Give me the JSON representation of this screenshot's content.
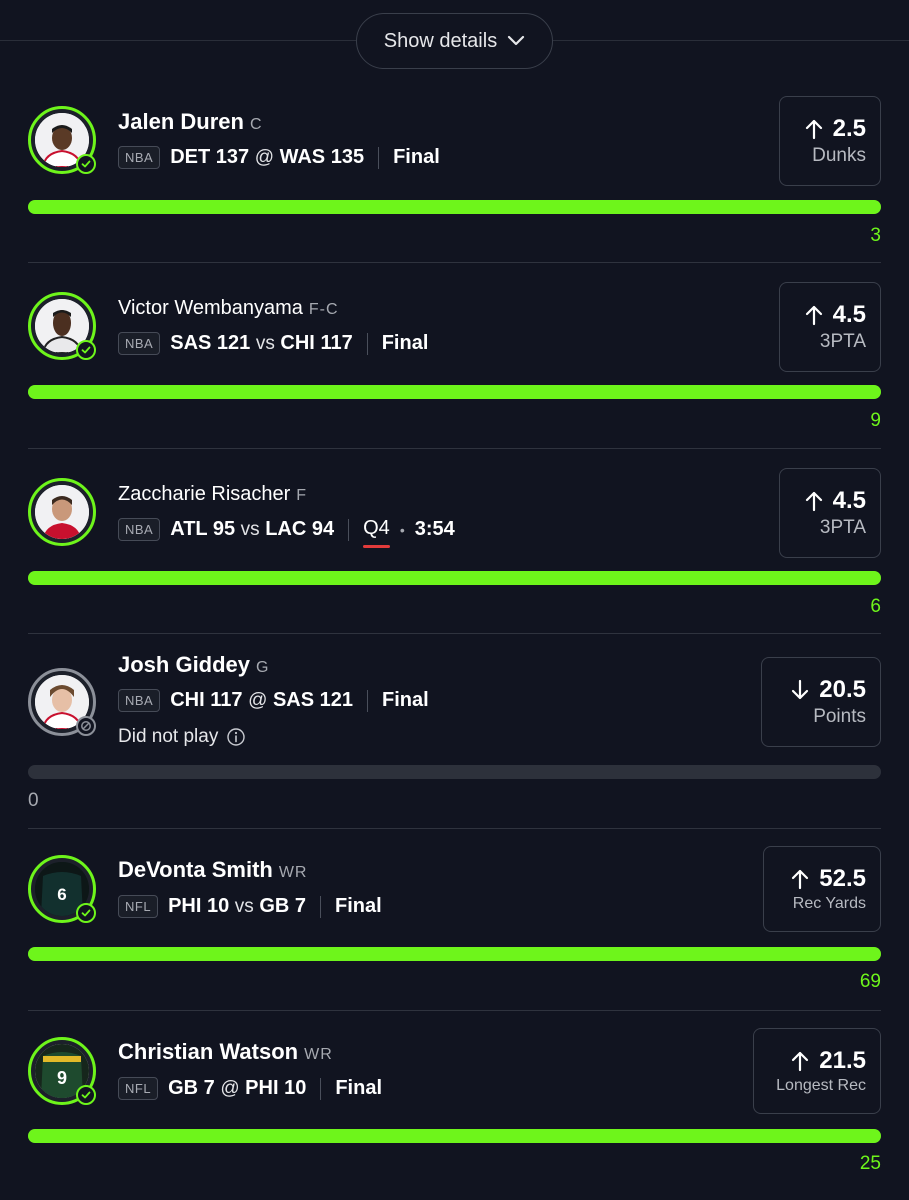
{
  "header": {
    "show_details_label": "Show details"
  },
  "colors": {
    "accent": "#6ef51b",
    "background": "#111420",
    "muted": "#8c9099",
    "live_red": "#e23b3b"
  },
  "picks": [
    {
      "name": "Jalen Duren",
      "position": "C",
      "league": "NBA",
      "score": {
        "team1": "DET",
        "pts1": "137",
        "conn": "@",
        "team2": "WAS",
        "pts2": "135"
      },
      "status": "Final",
      "direction": "up",
      "line": "2.5",
      "stat": "Dunks",
      "result": "3",
      "progress": 1.0,
      "outcome": "check"
    },
    {
      "name": "Victor Wembanyama",
      "position": "F-C",
      "league": "NBA",
      "score": {
        "team1": "SAS",
        "pts1": "121",
        "conn": "vs",
        "team2": "CHI",
        "pts2": "117"
      },
      "status": "Final",
      "direction": "up",
      "line": "4.5",
      "stat": "3PTA",
      "result": "9",
      "progress": 1.0,
      "outcome": "check"
    },
    {
      "name": "Zaccharie Risacher",
      "position": "F",
      "league": "NBA",
      "score": {
        "team1": "ATL",
        "pts1": "95",
        "conn": "vs",
        "team2": "LAC",
        "pts2": "94"
      },
      "quarter": "Q4",
      "clock": "3:54",
      "direction": "up",
      "line": "4.5",
      "stat": "3PTA",
      "result": "6",
      "progress": 1.0,
      "outcome": "none"
    },
    {
      "name": "Josh Giddey",
      "position": "G",
      "league": "NBA",
      "score": {
        "team1": "CHI",
        "pts1": "117",
        "conn": "@",
        "team2": "SAS",
        "pts2": "121"
      },
      "status": "Final",
      "note": "Did not play",
      "direction": "down",
      "line": "20.5",
      "stat": "Points",
      "result": "0",
      "progress": 0.0,
      "outcome": "void"
    },
    {
      "name": "DeVonta Smith",
      "position": "WR",
      "league": "NFL",
      "score": {
        "team1": "PHI",
        "pts1": "10",
        "conn": "vs",
        "team2": "GB",
        "pts2": "7"
      },
      "status": "Final",
      "direction": "up",
      "line": "52.5",
      "stat": "Rec Yards",
      "result": "69",
      "progress": 1.0,
      "outcome": "check"
    },
    {
      "name": "Christian Watson",
      "position": "WR",
      "league": "NFL",
      "score": {
        "team1": "GB",
        "pts1": "7",
        "conn": "@",
        "team2": "PHI",
        "pts2": "10"
      },
      "status": "Final",
      "direction": "up",
      "line": "21.5",
      "stat": "Longest Rec",
      "result": "25",
      "progress": 1.0,
      "outcome": "check"
    }
  ]
}
